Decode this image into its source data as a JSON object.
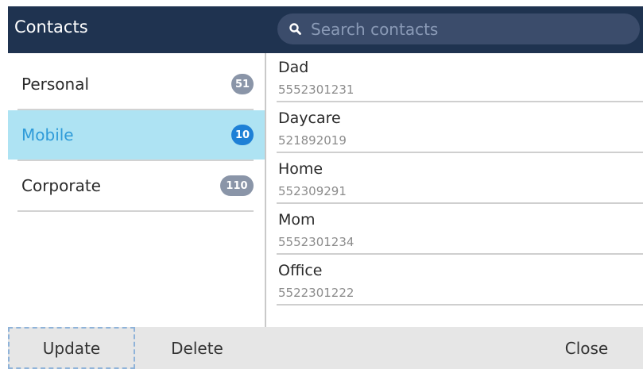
{
  "header": {
    "title": "Contacts",
    "search_placeholder": "Search contacts"
  },
  "categories": [
    {
      "label": "Personal",
      "count": "51",
      "selected": false
    },
    {
      "label": "Mobile",
      "count": "10",
      "selected": true
    },
    {
      "label": "Corporate",
      "count": "110",
      "selected": false
    }
  ],
  "contacts": [
    {
      "name": "Dad",
      "number": "5552301231"
    },
    {
      "name": "Daycare",
      "number": "521892019"
    },
    {
      "name": "Home",
      "number": "552309291"
    },
    {
      "name": "Mom",
      "number": "5552301234"
    },
    {
      "name": "Office",
      "number": "5522301222"
    }
  ],
  "softkeys": {
    "update": "Update",
    "delete": "Delete",
    "close": "Close"
  },
  "colors": {
    "header_bg": "#1f3350",
    "selected_bg": "#aee3f3",
    "selected_text": "#2f9bd9",
    "badge_selected": "#1e80d6",
    "badge_default": "#8a95a8"
  }
}
